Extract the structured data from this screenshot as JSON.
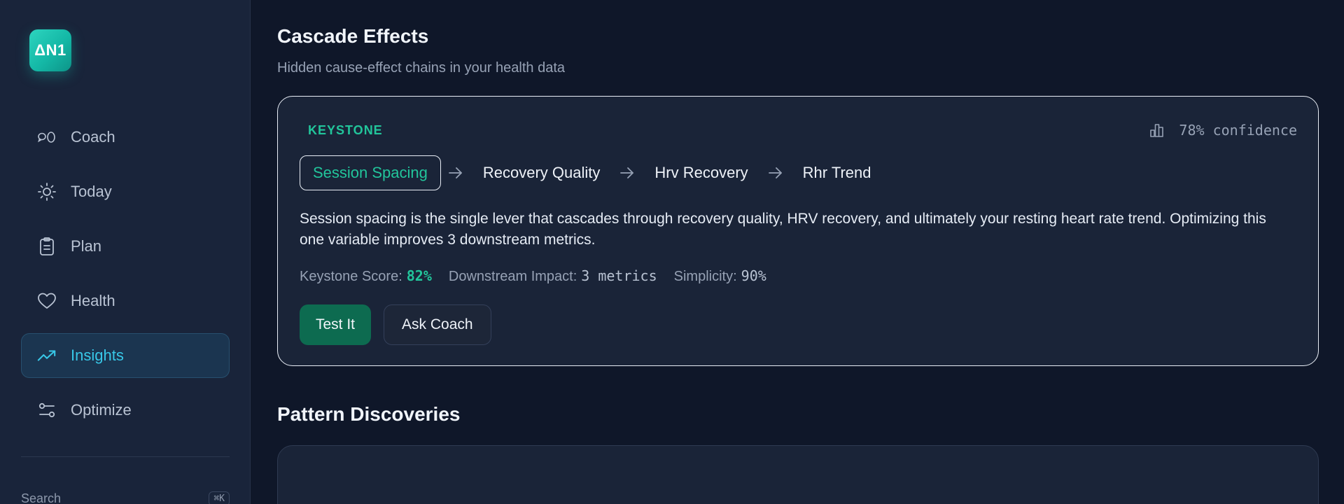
{
  "app": {
    "logo_text": "ΔN1"
  },
  "sidebar": {
    "items": [
      {
        "label": "Coach",
        "icon": "chat-icon",
        "active": false
      },
      {
        "label": "Today",
        "icon": "sun-icon",
        "active": false
      },
      {
        "label": "Plan",
        "icon": "clipboard-icon",
        "active": false
      },
      {
        "label": "Health",
        "icon": "heart-icon",
        "active": false
      },
      {
        "label": "Insights",
        "icon": "trending-up-icon",
        "active": true
      },
      {
        "label": "Optimize",
        "icon": "sliders-icon",
        "active": false
      }
    ],
    "search_label": "Search",
    "search_shortcut": "⌘K"
  },
  "cascade": {
    "title": "Cascade Effects",
    "subtitle": "Hidden cause-effect chains in your health data",
    "card": {
      "badge": "KEYSTONE",
      "confidence": "78% confidence",
      "chain": [
        "Session Spacing",
        "Recovery Quality",
        "Hrv Recovery",
        "Rhr Trend"
      ],
      "description": "Session spacing is the single lever that cascades through recovery quality, HRV recovery, and ultimately your resting heart rate trend. Optimizing this one variable improves 3 downstream metrics.",
      "metrics": {
        "keystone_label": "Keystone Score:",
        "keystone_value": "82%",
        "impact_label": "Downstream Impact:",
        "impact_value": "3 metrics",
        "simplicity_label": "Simplicity:",
        "simplicity_value": "90%"
      },
      "actions": {
        "primary": "Test It",
        "secondary": "Ask Coach"
      }
    }
  },
  "patterns": {
    "title": "Pattern Discoveries"
  },
  "colors": {
    "accent_green": "#22c59b",
    "accent_cyan": "#38c8e8",
    "background": "#0f1729"
  }
}
